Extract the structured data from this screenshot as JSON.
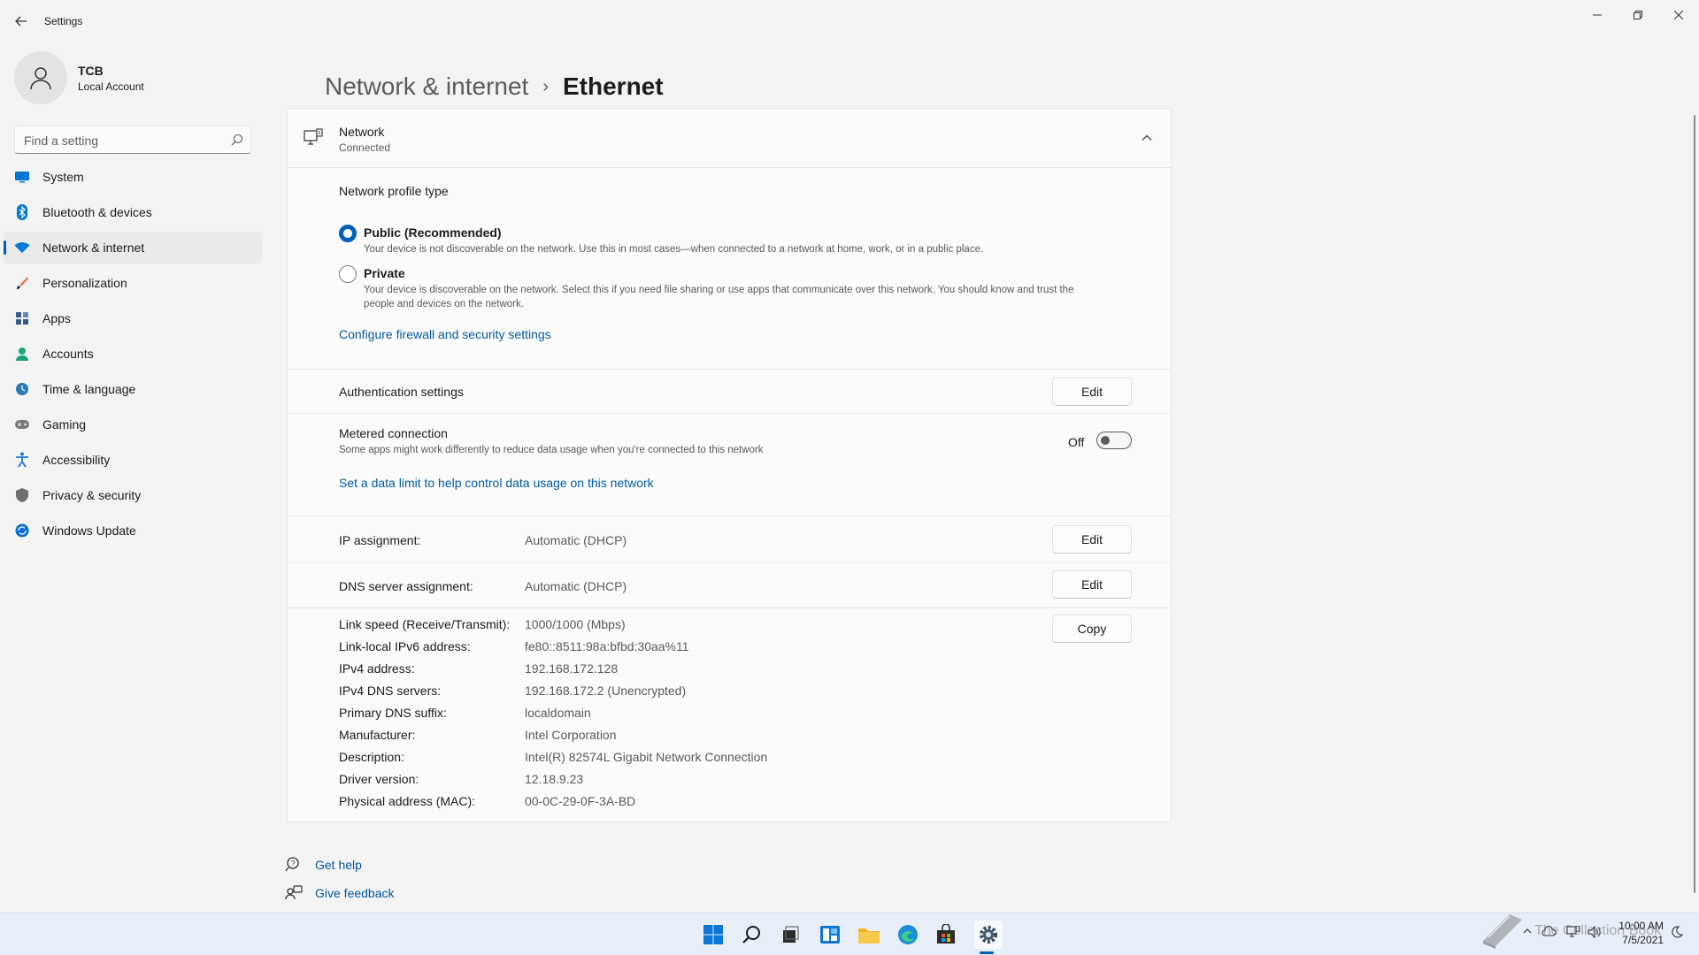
{
  "window": {
    "title": "Settings"
  },
  "user": {
    "name": "TCB",
    "account_type": "Local Account"
  },
  "search": {
    "placeholder": "Find a setting"
  },
  "nav": {
    "items": [
      {
        "label": "System",
        "icon": "monitor-icon",
        "color": "#0078d4"
      },
      {
        "label": "Bluetooth & devices",
        "icon": "bluetooth-icon",
        "color": "#0078d4"
      },
      {
        "label": "Network & internet",
        "icon": "wifi-icon",
        "color": "#0078d4",
        "active": true
      },
      {
        "label": "Personalization",
        "icon": "brush-icon",
        "color": "#e06c2f"
      },
      {
        "label": "Apps",
        "icon": "apps-icon",
        "color": "#3a5a8c"
      },
      {
        "label": "Accounts",
        "icon": "person-icon",
        "color": "#1aa37a"
      },
      {
        "label": "Time & language",
        "icon": "globe-clock-icon",
        "color": "#2a7ab8"
      },
      {
        "label": "Gaming",
        "icon": "gamepad-icon",
        "color": "#6e6e6e"
      },
      {
        "label": "Accessibility",
        "icon": "accessibility-icon",
        "color": "#1a7ad4"
      },
      {
        "label": "Privacy & security",
        "icon": "shield-icon",
        "color": "#6e6e6e"
      },
      {
        "label": "Windows Update",
        "icon": "update-icon",
        "color": "#0a6ed1"
      }
    ]
  },
  "breadcrumb": {
    "parent": "Network & internet",
    "separator": "›",
    "current": "Ethernet"
  },
  "network": {
    "title": "Network",
    "status": "Connected"
  },
  "profile": {
    "heading": "Network profile type",
    "public_label": "Public (Recommended)",
    "public_desc": "Your device is not discoverable on the network. Use this in most cases—when connected to a network at home, work, or in a public place.",
    "private_label": "Private",
    "private_desc_line1": "Your device is discoverable on the network. Select this if you need file sharing or use apps that communicate over this network. You should know and trust the",
    "private_desc_line2": "people and devices on the network.",
    "selected": "public",
    "firewall_link": "Configure firewall and security settings"
  },
  "auth": {
    "label": "Authentication settings",
    "button": "Edit"
  },
  "metered": {
    "label": "Metered connection",
    "desc": "Some apps might work differently to reduce data usage when you're connected to this network",
    "state_label": "Off",
    "data_limit_link": "Set a data limit to help control data usage on this network"
  },
  "ip": {
    "label": "IP assignment:",
    "value": "Automatic (DHCP)",
    "button": "Edit"
  },
  "dns": {
    "label": "DNS server assignment:",
    "value": "Automatic (DHCP)",
    "button": "Edit"
  },
  "properties": {
    "copy_button": "Copy",
    "rows": [
      {
        "label": "Link speed (Receive/Transmit):",
        "value": "1000/1000 (Mbps)"
      },
      {
        "label": "Link-local IPv6 address:",
        "value": "fe80::8511:98a:bfbd:30aa%11"
      },
      {
        "label": "IPv4 address:",
        "value": "192.168.172.128"
      },
      {
        "label": "IPv4 DNS servers:",
        "value": "192.168.172.2 (Unencrypted)"
      },
      {
        "label": "Primary DNS suffix:",
        "value": "localdomain"
      },
      {
        "label": "Manufacturer:",
        "value": "Intel Corporation"
      },
      {
        "label": "Description:",
        "value": "Intel(R) 82574L Gigabit Network Connection"
      },
      {
        "label": "Driver version:",
        "value": "12.18.9.23"
      },
      {
        "label": "Physical address (MAC):",
        "value": "00-0C-29-0F-3A-BD"
      }
    ]
  },
  "help": {
    "get_help": "Get help",
    "give_feedback": "Give feedback"
  },
  "taskbar": {
    "clock_time": "10:00 AM",
    "clock_date": "7/5/2021",
    "watermark": "The Collection Book",
    "accent": "#005fb8"
  }
}
